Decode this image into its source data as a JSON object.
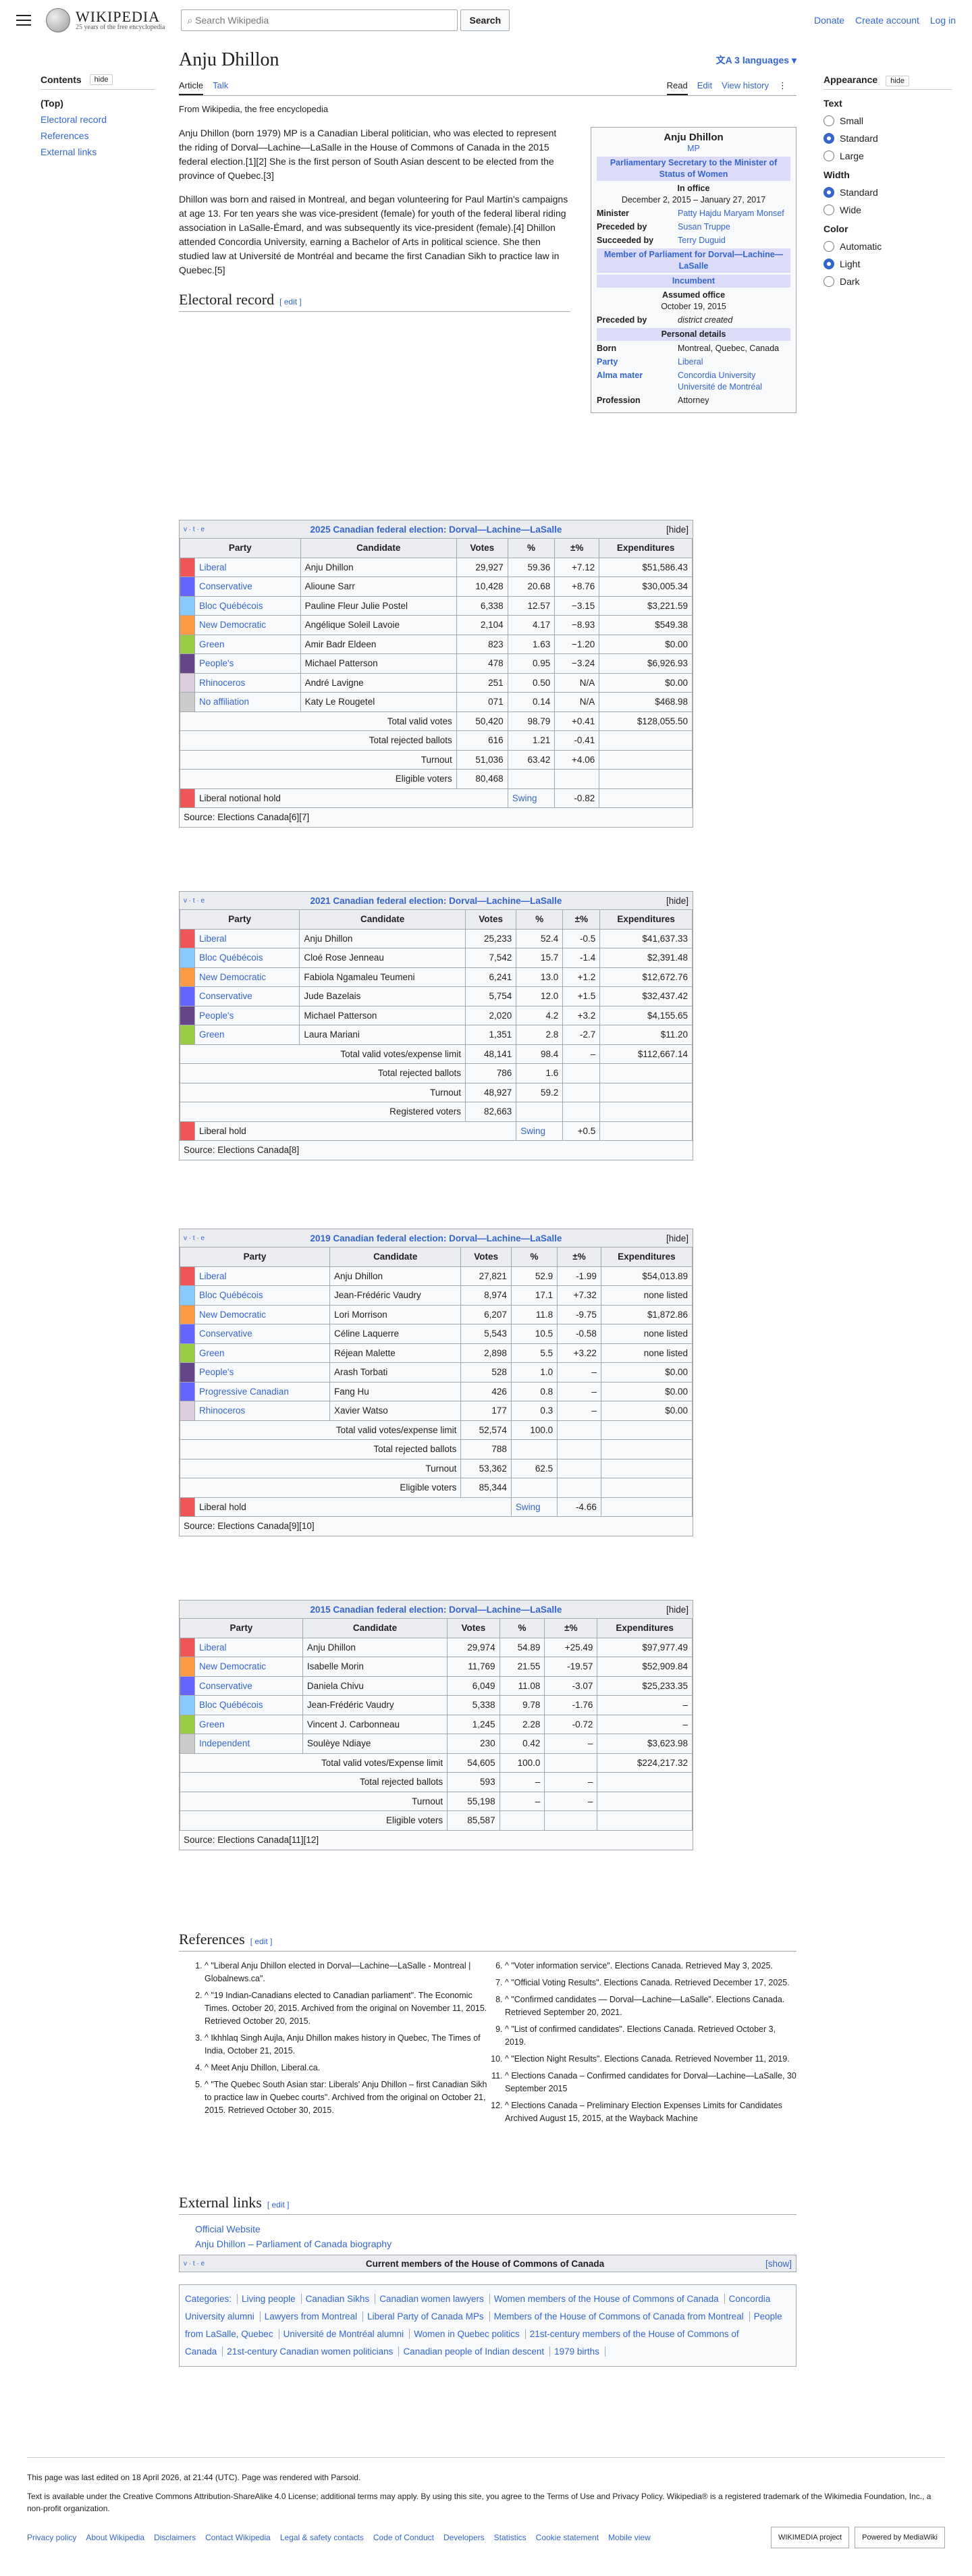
{
  "header": {
    "wordmark": "WIKIPEDIA",
    "tagline": "25 years of the free encyclopedia",
    "search_placeholder": "Search Wikipedia",
    "search_button": "Search",
    "donate": "Donate",
    "create": "Create account",
    "login": "Log in"
  },
  "toc": {
    "title": "Contents",
    "hide": "hide",
    "items": [
      "(Top)",
      "Electoral record",
      "References",
      "External links"
    ]
  },
  "article": {
    "title": "Anju Dhillon",
    "languages": "3 languages",
    "tab_article": "Article",
    "tab_talk": "Talk",
    "tab_read": "Read",
    "tab_edit": "Edit",
    "tab_history": "View history",
    "from": "From Wikipedia, the free encyclopedia",
    "p1": "Anju Dhillon (born 1979) MP is a Canadian Liberal politician, who was elected to represent the riding of Dorval—Lachine—LaSalle in the House of Commons of Canada in the 2015 federal election.[1][2] She is the first person of South Asian descent to be elected from the province of Quebec.[3]",
    "p2": "Dhillon was born and raised in Montreal, and began volunteering for Paul Martin's campaigns at age 13. For ten years she was vice-president (female) for youth of the federal liberal riding association in LaSalle-Émard, and was subsequently its vice-president (female).[4] Dhillon attended Concordia University, earning a Bachelor of Arts in political science. She then studied law at Université de Montréal and became the first Canadian Sikh to practice law in Quebec.[5]",
    "electoral": "Electoral record",
    "edit": "[ edit ]",
    "references": "References",
    "external": "External links"
  },
  "infobox": {
    "name": "Anju Dhillon",
    "mp": "MP",
    "role": "Parliamentary Secretary to the Minister of Status of Women",
    "office": "In office",
    "dates": "December 2, 2015 – January 27, 2017",
    "minister_l": "Minister",
    "minister": "Patty Hajdu Maryam Monsef",
    "prec_l": "Preceded by",
    "prec": "Susan Truppe",
    "succ_l": "Succeeded by",
    "succ": "Terry Duguid",
    "member": "Member of Parliament for Dorval—Lachine—LaSalle",
    "inc": "Incumbent",
    "assumed": "Assumed office",
    "assumed_date": "October 19, 2015",
    "prec2": "district created",
    "personal": "Personal details",
    "born_l": "Born",
    "born": "Montreal, Quebec, Canada",
    "party_l": "Party",
    "party": "Liberal",
    "alma_l": "Alma mater",
    "alma": "Concordia University Université de Montréal",
    "prof_l": "Profession",
    "prof": "Attorney"
  },
  "elections": [
    {
      "title": "2025 Canadian federal election: Dorval—Lachine—LaSalle",
      "vte": "v · t · e",
      "hide": "[hide]",
      "headers": [
        "Party",
        "Candidate",
        "Votes",
        "%",
        "±%",
        "Expenditures"
      ],
      "rows": [
        [
          "#e55",
          "Liberal",
          "Anju Dhillon",
          "29,927",
          "59.36",
          "+7.12",
          "$51,586.43"
        ],
        [
          "#66f",
          "Conservative",
          "Alioune Sarr",
          "10,428",
          "20.68",
          "+8.76",
          "$30,005.34"
        ],
        [
          "#8cf",
          "Bloc Québécois",
          "Pauline Fleur Julie Postel",
          "6,338",
          "12.57",
          "−3.15",
          "$3,221.59"
        ],
        [
          "#f94",
          "New Democratic",
          "Angélique Soleil Lavoie",
          "2,104",
          "4.17",
          "−8.93",
          "$549.38"
        ],
        [
          "#9c4",
          "Green",
          "Amir Badr Eldeen",
          "823",
          "1.63",
          "−1.20",
          "$0.00"
        ],
        [
          "#648",
          "People's",
          "Michael Patterson",
          "478",
          "0.95",
          "−3.24",
          "$6,926.93"
        ],
        [
          "#dcd",
          "Rhinoceros",
          "André Lavigne",
          "251",
          "0.50",
          "N/A",
          "$0.00"
        ],
        [
          "#ccc",
          "No affiliation",
          "Katy Le Rougetel",
          "071",
          "0.14",
          "N/A",
          "$468.98"
        ]
      ],
      "totals": [
        [
          "Total valid votes",
          "50,420",
          "98.79",
          "+0.41",
          "$128,055.50"
        ],
        [
          "Total rejected ballots",
          "616",
          "1.21",
          "-0.41",
          ""
        ],
        [
          "Turnout",
          "51,036",
          "63.42",
          "+4.06",
          ""
        ],
        [
          "Eligible voters",
          "80,468",
          "",
          "",
          ""
        ]
      ],
      "hold": "Liberal notional hold",
      "swing": "Swing",
      "swingv": "-0.82",
      "source": "Source: Elections Canada[6][7]"
    },
    {
      "title": "2021 Canadian federal election: Dorval—Lachine—LaSalle",
      "vte": "v · t · e",
      "hide": "[hide]",
      "headers": [
        "Party",
        "Candidate",
        "Votes",
        "%",
        "±%",
        "Expenditures"
      ],
      "rows": [
        [
          "#e55",
          "Liberal",
          "Anju Dhillon",
          "25,233",
          "52.4",
          "-0.5",
          "$41,637.33"
        ],
        [
          "#8cf",
          "Bloc Québécois",
          "Cloé Rose Jenneau",
          "7,542",
          "15.7",
          "-1.4",
          "$2,391.48"
        ],
        [
          "#f94",
          "New Democratic",
          "Fabiola Ngamaleu Teumeni",
          "6,241",
          "13.0",
          "+1.2",
          "$12,672.76"
        ],
        [
          "#66f",
          "Conservative",
          "Jude Bazelais",
          "5,754",
          "12.0",
          "+1.5",
          "$32,437.42"
        ],
        [
          "#648",
          "People's",
          "Michael Patterson",
          "2,020",
          "4.2",
          "+3.2",
          "$4,155.65"
        ],
        [
          "#9c4",
          "Green",
          "Laura Mariani",
          "1,351",
          "2.8",
          "-2.7",
          "$11.20"
        ]
      ],
      "totals": [
        [
          "Total valid votes/expense limit",
          "48,141",
          "98.4",
          "–",
          "$112,667.14"
        ],
        [
          "Total rejected ballots",
          "786",
          "1.6",
          "",
          ""
        ],
        [
          "Turnout",
          "48,927",
          "59.2",
          "",
          ""
        ],
        [
          "Registered voters",
          "82,663",
          "",
          "",
          ""
        ]
      ],
      "hold": "Liberal hold",
      "swing": "Swing",
      "swingv": "+0.5",
      "source": "Source: Elections Canada[8]"
    },
    {
      "title": "2019 Canadian federal election: Dorval—Lachine—LaSalle",
      "vte": "v · t · e",
      "hide": "[hide]",
      "headers": [
        "Party",
        "Candidate",
        "Votes",
        "%",
        "±%",
        "Expenditures"
      ],
      "rows": [
        [
          "#e55",
          "Liberal",
          "Anju Dhillon",
          "27,821",
          "52.9",
          "-1.99",
          "$54,013.89"
        ],
        [
          "#8cf",
          "Bloc Québécois",
          "Jean-Frédéric Vaudry",
          "8,974",
          "17.1",
          "+7.32",
          "none listed"
        ],
        [
          "#f94",
          "New Democratic",
          "Lori Morrison",
          "6,207",
          "11.8",
          "-9.75",
          "$1,872.86"
        ],
        [
          "#66f",
          "Conservative",
          "Céline Laquerre",
          "5,543",
          "10.5",
          "-0.58",
          "none listed"
        ],
        [
          "#9c4",
          "Green",
          "Réjean Malette",
          "2,898",
          "5.5",
          "+3.22",
          "none listed"
        ],
        [
          "#648",
          "People's",
          "Arash Torbati",
          "528",
          "1.0",
          "–",
          "$0.00"
        ],
        [
          "#66f",
          "Progressive Canadian",
          "Fang Hu",
          "426",
          "0.8",
          "–",
          "$0.00"
        ],
        [
          "#dcd",
          "Rhinoceros",
          "Xavier Watso",
          "177",
          "0.3",
          "–",
          "$0.00"
        ]
      ],
      "totals": [
        [
          "Total valid votes/expense limit",
          "52,574",
          "100.0",
          "",
          ""
        ],
        [
          "Total rejected ballots",
          "788",
          "",
          "",
          ""
        ],
        [
          "Turnout",
          "53,362",
          "62.5",
          "",
          ""
        ],
        [
          "Eligible voters",
          "85,344",
          "",
          "",
          ""
        ]
      ],
      "hold": "Liberal hold",
      "swing": "Swing",
      "swingv": "-4.66",
      "source": "Source: Elections Canada[9][10]"
    },
    {
      "title": "2015 Canadian federal election: Dorval—Lachine—LaSalle",
      "vte": "",
      "hide": "[hide]",
      "headers": [
        "Party",
        "Candidate",
        "Votes",
        "%",
        "±%",
        "Expenditures"
      ],
      "rows": [
        [
          "#e55",
          "Liberal",
          "Anju Dhillon",
          "29,974",
          "54.89",
          "+25.49",
          "$97,977.49"
        ],
        [
          "#f94",
          "New Democratic",
          "Isabelle Morin",
          "11,769",
          "21.55",
          "-19.57",
          "$52,909.84"
        ],
        [
          "#66f",
          "Conservative",
          "Daniela Chivu",
          "6,049",
          "11.08",
          "-3.07",
          "$25,233.35"
        ],
        [
          "#8cf",
          "Bloc Québécois",
          "Jean-Frédéric Vaudry",
          "5,338",
          "9.78",
          "-1.76",
          "–"
        ],
        [
          "#9c4",
          "Green",
          "Vincent J. Carbonneau",
          "1,245",
          "2.28",
          "-0.72",
          "–"
        ],
        [
          "#ccc",
          "Independent",
          "Soulèye Ndiaye",
          "230",
          "0.42",
          "–",
          "$3,623.98"
        ]
      ],
      "totals": [
        [
          "Total valid votes/Expense limit",
          "54,605",
          "100.0",
          "",
          "$224,217.32"
        ],
        [
          "Total rejected ballots",
          "593",
          "–",
          "–",
          ""
        ],
        [
          "Turnout",
          "55,198",
          "–",
          "–",
          ""
        ],
        [
          "Eligible voters",
          "85,587",
          "",
          "",
          ""
        ]
      ],
      "hold": "",
      "swing": "",
      "swingv": "",
      "source": "Source: Elections Canada[11][12]"
    }
  ],
  "references": [
    "^ \"Liberal Anju Dhillon elected in Dorval—Lachine—LaSalle - Montreal | Globalnews.ca\".",
    "^ \"19 Indian-Canadians elected to Canadian parliament\". The Economic Times. October 20, 2015. Archived from the original on November 11, 2015. Retrieved October 20, 2015.",
    "^ Ikhhlaq Singh Aujla, Anju Dhillon makes history in Quebec, The Times of India, October 21, 2015.",
    "^ Meet Anju Dhillon, Liberal.ca.",
    "^ \"The Quebec South Asian star: Liberals' Anju Dhillon – first Canadian Sikh to practice law in Quebec courts\". Archived from the original on October 21, 2015. Retrieved October 30, 2015.",
    "^ \"Voter information service\". Elections Canada. Retrieved May 3, 2025.",
    "^ \"Official Voting Results\". Elections Canada. Retrieved December 17, 2025.",
    "^ \"Confirmed candidates — Dorval—Lachine—LaSalle\". Elections Canada. Retrieved September 20, 2021.",
    "^ \"List of confirmed candidates\". Elections Canada. Retrieved October 3, 2019.",
    "^ \"Election Night Results\". Elections Canada. Retrieved November 11, 2019.",
    "^ Elections Canada – Confirmed candidates for Dorval—Lachine—LaSalle, 30 September 2015",
    "^ Elections Canada – Preliminary Election Expenses Limits for Candidates Archived August 15, 2015, at the Wayback Machine"
  ],
  "external": [
    "Official Website",
    "Anju Dhillon – Parliament of Canada biography"
  ],
  "navbox": {
    "vte": "v · t · e",
    "title": "Current members of the House of Commons of Canada",
    "show": "[show]"
  },
  "categories": [
    "Categories:",
    "Living people",
    "Canadian Sikhs",
    "Canadian women lawyers",
    "Women members of the House of Commons of Canada",
    "Concordia University alumni",
    "Lawyers from Montreal",
    "Liberal Party of Canada MPs",
    "Members of the House of Commons of Canada from Montreal",
    "People from LaSalle, Quebec",
    "Université de Montréal alumni",
    "Women in Quebec politics",
    "21st-century members of the House of Commons of Canada",
    "21st-century Canadian women politicians",
    "Canadian people of Indian descent",
    "1979 births"
  ],
  "appearance": {
    "title": "Appearance",
    "hide": "hide",
    "text": "Text",
    "t_opts": [
      "Small",
      "Standard",
      "Large"
    ],
    "width": "Width",
    "w_opts": [
      "Standard",
      "Wide"
    ],
    "color": "Color",
    "c_opts": [
      "Automatic",
      "Light",
      "Dark"
    ]
  },
  "footer": {
    "edited": "This page was last edited on 18 April 2026, at 21:44 (UTC). Page was rendered with Parsoid.",
    "license": "Text is available under the Creative Commons Attribution-ShareAlike 4.0 License; additional terms may apply. By using this site, you agree to the Terms of Use and Privacy Policy. Wikipedia® is a registered trademark of the Wikimedia Foundation, Inc., a non-profit organization.",
    "links": [
      "Privacy policy",
      "About Wikipedia",
      "Disclaimers",
      "Contact Wikipedia",
      "Legal & safety contacts",
      "Code of Conduct",
      "Developers",
      "Statistics",
      "Cookie statement",
      "Mobile view"
    ],
    "badge1": "WIKIMEDIA project",
    "badge2": "Powered by MediaWiki"
  }
}
